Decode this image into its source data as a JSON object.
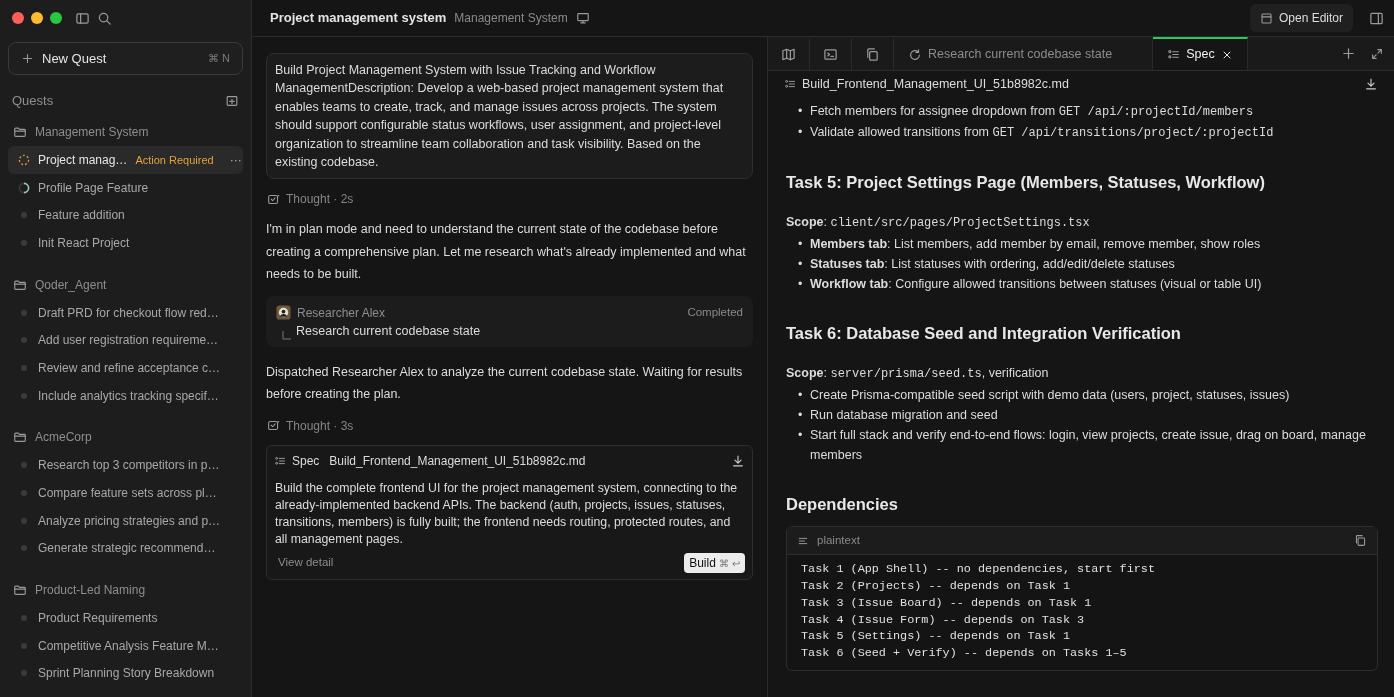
{
  "sidebar": {
    "new_quest": {
      "label": "New Quest",
      "shortcut": "⌘ N"
    },
    "section_title": "Quests",
    "groups": [
      {
        "name": "Management System",
        "items": [
          {
            "title": "Project manag…",
            "kind": "pending",
            "selected": true,
            "badge": "Action Required",
            "more": "···"
          },
          {
            "title": "Profile Page Feature",
            "kind": "running",
            "selected": false
          },
          {
            "title": "Feature addition",
            "kind": "idle",
            "selected": false
          },
          {
            "title": "Init React Project",
            "kind": "idle",
            "selected": false
          }
        ]
      },
      {
        "name": "Qoder_Agent",
        "items": [
          {
            "title": "Draft PRD for checkout flow red…",
            "kind": "idle",
            "selected": false
          },
          {
            "title": "Add user registration requireme…",
            "kind": "idle",
            "selected": false
          },
          {
            "title": "Review and refine acceptance c…",
            "kind": "idle",
            "selected": false
          },
          {
            "title": "Include analytics tracking specif…",
            "kind": "idle",
            "selected": false
          }
        ]
      },
      {
        "name": "AcmeCorp",
        "items": [
          {
            "title": "Research top 3 competitors in p…",
            "kind": "idle",
            "selected": false
          },
          {
            "title": "Compare feature sets across pl…",
            "kind": "idle",
            "selected": false
          },
          {
            "title": "Analyze pricing strategies and p…",
            "kind": "idle",
            "selected": false
          },
          {
            "title": "Generate strategic recommend…",
            "kind": "idle",
            "selected": false
          }
        ]
      },
      {
        "name": "Product-Led Naming",
        "items": [
          {
            "title": "Product Requirements",
            "kind": "idle",
            "selected": false
          },
          {
            "title": "Competitive Analysis Feature M…",
            "kind": "idle",
            "selected": false
          },
          {
            "title": "Sprint Planning Story Breakdown",
            "kind": "idle",
            "selected": false
          }
        ]
      }
    ]
  },
  "header": {
    "title": "Project management system",
    "subtitle": "Management System",
    "open_editor": "Open Editor"
  },
  "chat": {
    "messages": [
      {
        "kind": "prompt",
        "text": "Build Project Management System with Issue Tracking and Workflow ManagementDescription: Develop a web-based project management system that enables teams to create, track, and manage issues across projects. The system should support configurable status workflows, user assignment, and project-level organization to streamline team collaboration and task visibility. Based on the existing codebase."
      },
      {
        "kind": "thought",
        "text": "Thought · 2s"
      },
      {
        "kind": "text",
        "text": "I'm in plan mode and need to understand the current state of the codebase before creating a comprehensive plan. Let me research what's already implemented and what needs to be built."
      },
      {
        "kind": "agent",
        "name": "Researcher Alex",
        "status": "Completed",
        "task": "Research current codebase state"
      },
      {
        "kind": "text",
        "text": "Dispatched Researcher Alex to analyze the current codebase state. Waiting for results before creating the plan."
      },
      {
        "kind": "thought",
        "text": "Thought · 3s"
      },
      {
        "kind": "spec",
        "label": "Spec",
        "file": "Build_Frontend_Management_UI_51b8982c.md",
        "body": "Build the complete frontend UI for the project management system, connecting to the already-implemented backend APIs. The backend (auth, projects, issues, statuses, transitions, members) is fully built; the frontend needs routing, protected routes, and all management pages.",
        "link": "View detail",
        "button": "Build",
        "shortcut": "⌘ ↩"
      }
    ]
  },
  "panel": {
    "tabs": [
      {
        "kind": "icon",
        "selected": false
      },
      {
        "kind": "icon",
        "selected": false
      },
      {
        "kind": "icon",
        "selected": false
      },
      {
        "kind": "task",
        "label": "Research current codebase state",
        "selected": false
      },
      {
        "kind": "spec",
        "label": "Spec",
        "selected": true,
        "closable": true
      }
    ],
    "document": {
      "file": "Build_Frontend_Management_UI_51b8982c.md",
      "blocks": [
        {
          "kind": "bullets",
          "marker": "•",
          "items": [
            [
              {
                "kind": "text",
                "text": "Fetch members for assignee dropdown from "
              },
              {
                "kind": "code",
                "text": "GET /api/:projectId/members"
              }
            ],
            [
              {
                "kind": "text",
                "text": "Validate allowed transitions from "
              },
              {
                "kind": "code",
                "text": "GET /api/transitions/project/:projectId"
              }
            ]
          ]
        },
        {
          "kind": "heading",
          "text": "Task 5: Project Settings Page (Members, Statuses, Workflow)"
        },
        {
          "kind": "paragraph",
          "parts": [
            {
              "kind": "text",
              "text": "**Scope**: "
            },
            {
              "kind": "code",
              "text": "client/src/pages/ProjectSettings.tsx"
            }
          ]
        },
        {
          "kind": "bullets",
          "marker": "•",
          "items": [
            [
              {
                "kind": "text",
                "text": "**Members tab**: List members, add member by email, remove member, show roles"
              }
            ],
            [
              {
                "kind": "text",
                "text": "**Statuses tab**: List statuses with ordering, add/edit/delete statuses"
              }
            ],
            [
              {
                "kind": "text",
                "text": "**Workflow tab**: Configure allowed transitions between statuses (visual or table UI)"
              }
            ]
          ]
        },
        {
          "kind": "heading",
          "text": "Task 6: Database Seed and Integration Verification"
        },
        {
          "kind": "paragraph",
          "parts": [
            {
              "kind": "text",
              "text": "**Scope**: "
            },
            {
              "kind": "code",
              "text": "server/prisma/seed.ts"
            },
            {
              "kind": "text",
              "text": ", verification"
            }
          ]
        },
        {
          "kind": "bullets",
          "marker": "•",
          "items": [
            [
              {
                "kind": "text",
                "text": "Create Prisma-compatible seed script with demo data (users, project, statuses, issues)"
              }
            ],
            [
              {
                "kind": "text",
                "text": "Run database migration and seed"
              }
            ],
            [
              {
                "kind": "text",
                "text": "Start full stack and verify end-to-end flows: login, view projects, create issue, drag on board, manage members"
              }
            ]
          ]
        },
        {
          "kind": "heading",
          "text": "Dependencies"
        },
        {
          "kind": "code",
          "language": "plaintext",
          "lines": [
            "Task 1 (App Shell) -- no dependencies, start first",
            "Task 2 (Projects) -- depends on Task 1",
            "Task 3 (Issue Board) -- depends on Task 1",
            "Task 4 (Issue Form) -- depends on Task 3",
            "Task 5 (Settings) -- depends on Task 1",
            "Task 6 (Seed + Verify) -- depends on Tasks 1–5"
          ]
        }
      ]
    }
  }
}
